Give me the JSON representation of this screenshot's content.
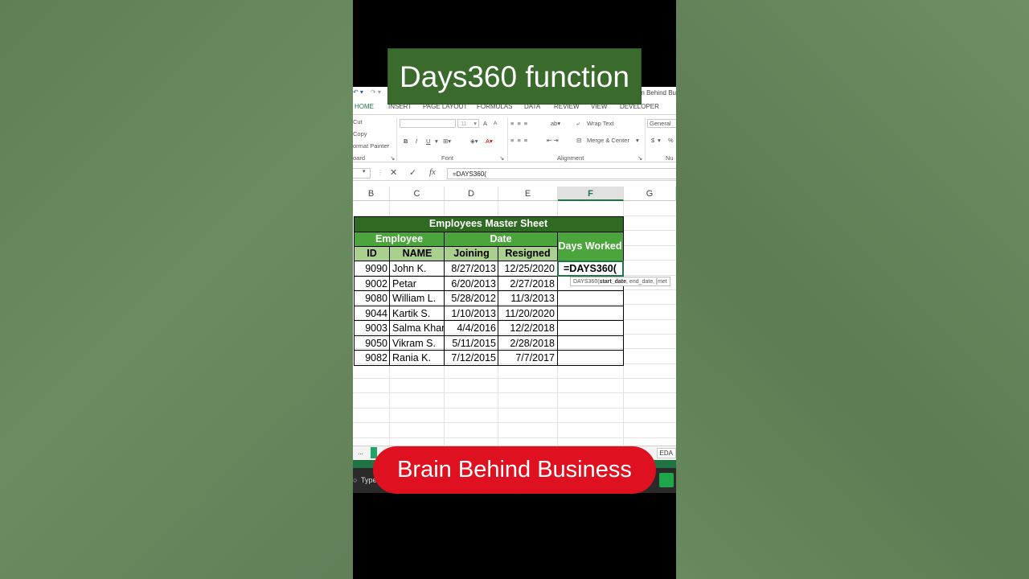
{
  "overlay": {
    "title": "Days360 function",
    "brand": "Brain Behind Business"
  },
  "window": {
    "title_fragment": "ain Behind Bu"
  },
  "ribbon_tabs": [
    "HOME",
    "INSERT",
    "PAGE LAYOUT",
    "FORMULAS",
    "DATA",
    "REVIEW",
    "VIEW",
    "DEVELOPER"
  ],
  "ribbon": {
    "cut": "Cut",
    "copy": "Copy",
    "format_painter": "ormat Painter",
    "clipboard_group": "oard",
    "font_size": "11",
    "grow_font": "A",
    "shrink_font": "A",
    "bold": "B",
    "italic": "I",
    "underline": "U",
    "font_group": "Font",
    "wrap_text": "Wrap Text",
    "merge_center": "Merge & Center",
    "alignment_group": "Alignment",
    "number_format": "General",
    "currency": "$",
    "percent": "%",
    "number_group": "Nu"
  },
  "formula_bar": {
    "content": "=DAYS360(",
    "fx": "fx"
  },
  "columns": [
    "B",
    "C",
    "D",
    "E",
    "F",
    "G"
  ],
  "selected_column": "F",
  "sheet": {
    "title": "Employees Master Sheet",
    "group_employee": "Employee",
    "group_date": "Date",
    "days_worked": "Days Worked",
    "col_id": "ID",
    "col_name": "NAME",
    "col_joining": "Joining",
    "col_resigned": "Resigned",
    "rows": [
      {
        "id": "9090",
        "name": "John K.",
        "joining": "8/27/2013",
        "resigned": "12/25/2020",
        "days": "=DAYS360("
      },
      {
        "id": "9002",
        "name": "Petar",
        "joining": "6/20/2013",
        "resigned": "2/27/2018",
        "days": ""
      },
      {
        "id": "9080",
        "name": "William L.",
        "joining": "5/28/2012",
        "resigned": "11/3/2013",
        "days": ""
      },
      {
        "id": "9044",
        "name": "Kartik S.",
        "joining": "1/10/2013",
        "resigned": "11/20/2020",
        "days": ""
      },
      {
        "id": "9003",
        "name": "Salma Khan",
        "joining": "4/4/2016",
        "resigned": "12/2/2018",
        "days": ""
      },
      {
        "id": "9050",
        "name": "Vikram S.",
        "joining": "5/11/2015",
        "resigned": "2/28/2018",
        "days": ""
      },
      {
        "id": "9082",
        "name": "Rania K.",
        "joining": "7/12/2015",
        "resigned": "7/7/2017",
        "days": ""
      }
    ]
  },
  "tooltip": {
    "fn": "DAYS360(",
    "arg1": "start_date",
    "rest": ", end_date, [met"
  },
  "sheet_tabs": {
    "more": "...",
    "tab_right": "EDA"
  },
  "taskbar": {
    "search": "Type"
  },
  "colors": {
    "header_dark": "#2e6a22",
    "header_mid": "#4ca43c",
    "header_light": "#a9d08e",
    "excel_green": "#217346",
    "brand_red": "#df1020",
    "title_green": "#3b6b2c"
  }
}
